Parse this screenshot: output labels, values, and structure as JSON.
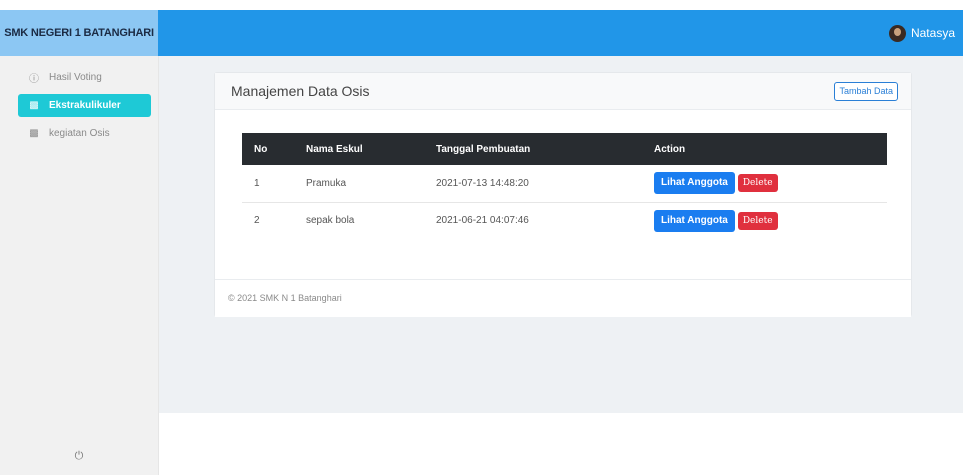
{
  "header": {
    "brand": "SMK NEGERI 1 BATANGHARI",
    "user_name": "Natasya"
  },
  "sidebar": {
    "items": [
      {
        "label": "Hasil Voting",
        "icon": "ballot-circle-icon",
        "active": false
      },
      {
        "label": "Ekstrakulikuler",
        "icon": "book-icon",
        "active": true
      },
      {
        "label": "kegiatan Osis",
        "icon": "book-icon",
        "active": false
      }
    ],
    "power_icon": "⏻"
  },
  "card": {
    "title": "Manajemen Data Osis",
    "add_button": "Tambah Data"
  },
  "table": {
    "headers": [
      "No",
      "Nama Eskul",
      "Tanggal Pembuatan",
      "Action"
    ],
    "rows": [
      {
        "no": "1",
        "nama": "Pramuka",
        "tanggal": "2021-07-13 14:48:20",
        "view": "Lihat Anggota",
        "delete": "Delete"
      },
      {
        "no": "2",
        "nama": "sepak bola",
        "tanggal": "2021-06-21 04:07:46",
        "view": "Lihat Anggota",
        "delete": "Delete"
      }
    ]
  },
  "footer": {
    "text": "© 2021 SMK N 1 Batanghari"
  },
  "colors": {
    "topbar": "#2196e8",
    "active_nav": "#1ec9d6",
    "primary": "#1a7df0",
    "danger": "#e0303e",
    "table_head": "#282c30"
  }
}
